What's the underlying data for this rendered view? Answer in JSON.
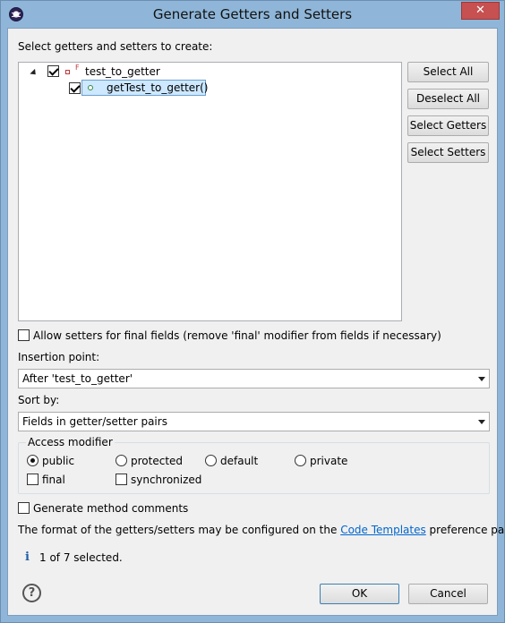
{
  "window": {
    "title": "Generate Getters and Setters",
    "close_label": "✕"
  },
  "tree": {
    "section_label": "Select getters and setters to create:",
    "field_node": {
      "label": "test_to_getter",
      "checked": true,
      "final_mark": "F"
    },
    "method_node": {
      "label": "getTest_to_getter()",
      "checked": true
    }
  },
  "side_buttons": {
    "select_all": "Select All",
    "deselect_all": "Deselect All",
    "select_getters": "Select Getters",
    "select_setters": "Select Setters"
  },
  "allow_setters": {
    "label": "Allow setters for final fields (remove 'final' modifier from fields if necessary)",
    "checked": false
  },
  "insertion_point": {
    "label": "Insertion point:",
    "value": "After 'test_to_getter'"
  },
  "sort_by": {
    "label": "Sort by:",
    "value": "Fields in getter/setter pairs"
  },
  "access_modifier": {
    "title": "Access modifier",
    "radios": [
      {
        "label": "public",
        "checked": true
      },
      {
        "label": "protected",
        "checked": false
      },
      {
        "label": "default",
        "checked": false
      },
      {
        "label": "private",
        "checked": false
      }
    ],
    "final_label": "final",
    "synchronized_label": "synchronized"
  },
  "generate_comments": {
    "label": "Generate method comments",
    "checked": false
  },
  "format_note": {
    "prefix": "The format of the getters/setters may be configured on the ",
    "link": "Code Templates",
    "suffix": " preference page."
  },
  "status": {
    "icon": "info-icon",
    "text": "1 of 7 selected."
  },
  "footer": {
    "ok_label": "OK",
    "cancel_label": "Cancel",
    "help_symbol": "?"
  },
  "colors": {
    "accent": "#3c7fb1",
    "link": "#0066cc",
    "selection": "#cde8ff"
  }
}
